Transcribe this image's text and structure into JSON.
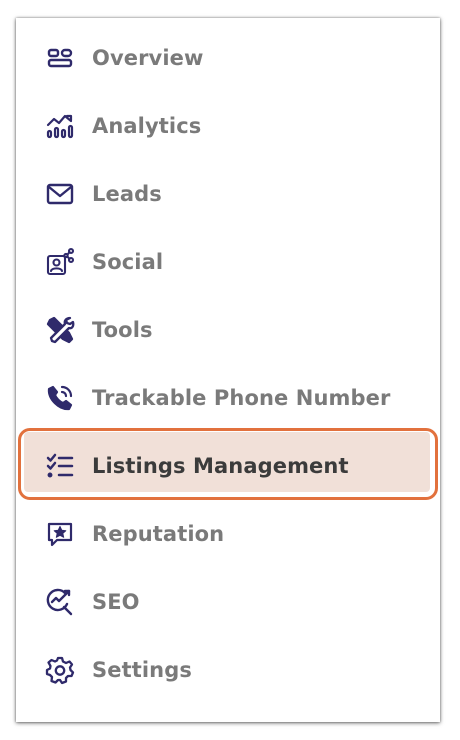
{
  "nav": {
    "items": [
      {
        "label": "Overview",
        "icon": "dashboard-icon"
      },
      {
        "label": "Analytics",
        "icon": "analytics-chart-icon"
      },
      {
        "label": "Leads",
        "icon": "envelope-icon"
      },
      {
        "label": "Social",
        "icon": "social-share-icon"
      },
      {
        "label": "Tools",
        "icon": "tools-icon"
      },
      {
        "label": "Trackable Phone Number",
        "icon": "phone-tracking-icon"
      },
      {
        "label": "Listings Management",
        "icon": "checklist-icon",
        "active": true
      },
      {
        "label": "Reputation",
        "icon": "star-chat-icon"
      },
      {
        "label": "SEO",
        "icon": "seo-magnifier-icon"
      },
      {
        "label": "Settings",
        "icon": "gear-icon"
      }
    ]
  },
  "colors": {
    "icon": "#2f2a6b",
    "label": "#7a7a7a",
    "active_label": "#3b3b3b",
    "active_background": "#f1e0d8",
    "highlight_border": "#e2713d"
  }
}
